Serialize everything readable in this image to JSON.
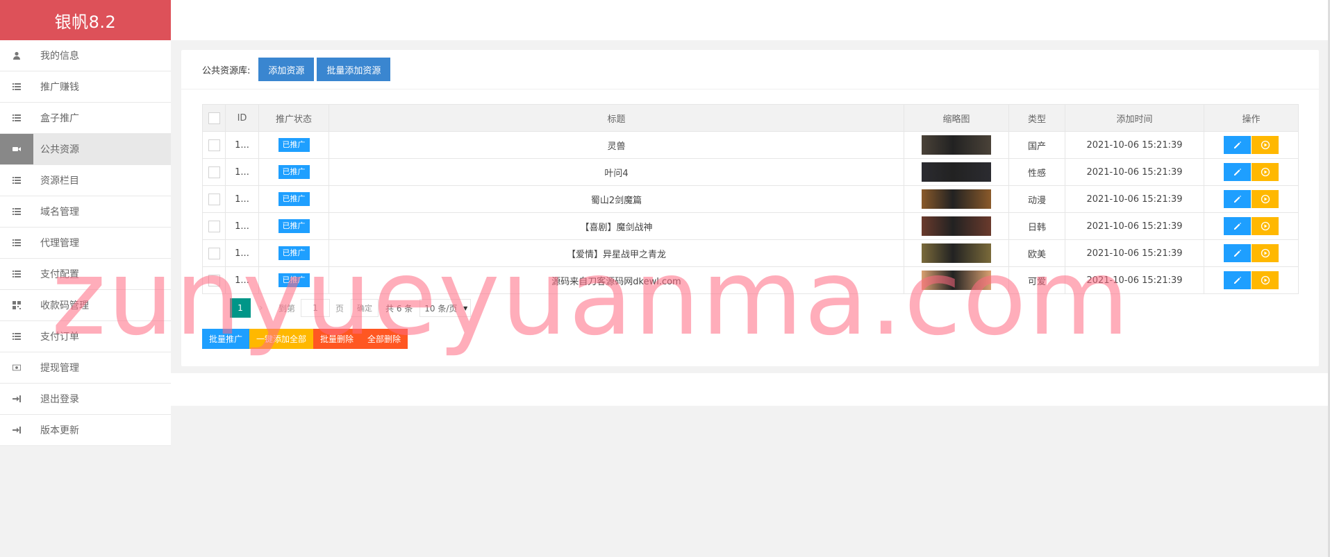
{
  "brand": {
    "title": "银帆8.2",
    "color": "#dd5159"
  },
  "sidebar": {
    "items": [
      {
        "label": "我的信息",
        "icon": "user-icon"
      },
      {
        "label": "推广赚钱",
        "icon": "list-icon"
      },
      {
        "label": "盒子推广",
        "icon": "list-icon"
      },
      {
        "label": "公共资源",
        "icon": "video-camera-icon",
        "active": true
      },
      {
        "label": "资源栏目",
        "icon": "list-icon"
      },
      {
        "label": "域名管理",
        "icon": "list-icon"
      },
      {
        "label": "代理管理",
        "icon": "list-icon"
      },
      {
        "label": "支付配置",
        "icon": "list-icon"
      },
      {
        "label": "收款码管理",
        "icon": "qrcode-icon"
      },
      {
        "label": "支付订单",
        "icon": "list-icon"
      },
      {
        "label": "提现管理",
        "icon": "money-icon"
      },
      {
        "label": "退出登录",
        "icon": "sign-in-icon"
      },
      {
        "label": "版本更新",
        "icon": "sign-in-icon"
      }
    ]
  },
  "header": {
    "library_label": "公共资源库:",
    "add_button": "添加资源",
    "batch_add_button": "批量添加资源"
  },
  "table": {
    "columns": [
      "ID",
      "推广状态",
      "标题",
      "缩略图",
      "类型",
      "添加时间",
      "操作"
    ],
    "rows": [
      {
        "id": "1...",
        "status": "已推广",
        "title": "灵兽",
        "type": "国产",
        "time": "2021-10-06 15:21:39",
        "thumb_color": "#4a4238"
      },
      {
        "id": "1...",
        "status": "已推广",
        "title": "叶问4",
        "type": "性感",
        "time": "2021-10-06 15:21:39",
        "thumb_color": "#2b2b30"
      },
      {
        "id": "1...",
        "status": "已推广",
        "title": "蜀山2剑魔篇",
        "type": "动漫",
        "time": "2021-10-06 15:21:39",
        "thumb_color": "#8a5a2a"
      },
      {
        "id": "1...",
        "status": "已推广",
        "title": "【喜剧】魔剑战神",
        "type": "日韩",
        "time": "2021-10-06 15:21:39",
        "thumb_color": "#6a3a2c"
      },
      {
        "id": "1...",
        "status": "已推广",
        "title": "【爱情】异星战甲之青龙",
        "type": "欧美",
        "time": "2021-10-06 15:21:39",
        "thumb_color": "#7a6a3a"
      },
      {
        "id": "1...",
        "status": "已推广",
        "title": "源码来自刀客源码网dkewl.com",
        "type": "可爱",
        "time": "2021-10-06 15:21:39",
        "thumb_color": "#d9a070"
      }
    ]
  },
  "pager": {
    "current": "1",
    "goto_label": "到第",
    "page_input": "1",
    "page_unit": "页",
    "confirm": "确定",
    "total": "共 6 条",
    "page_size": "10 条/页"
  },
  "actions": {
    "batch_promote": "批量推广",
    "add_all": "一键添加全部",
    "batch_delete": "批量删除",
    "delete_all": "全部删除"
  },
  "watermark": "zunyueyuanma.com"
}
